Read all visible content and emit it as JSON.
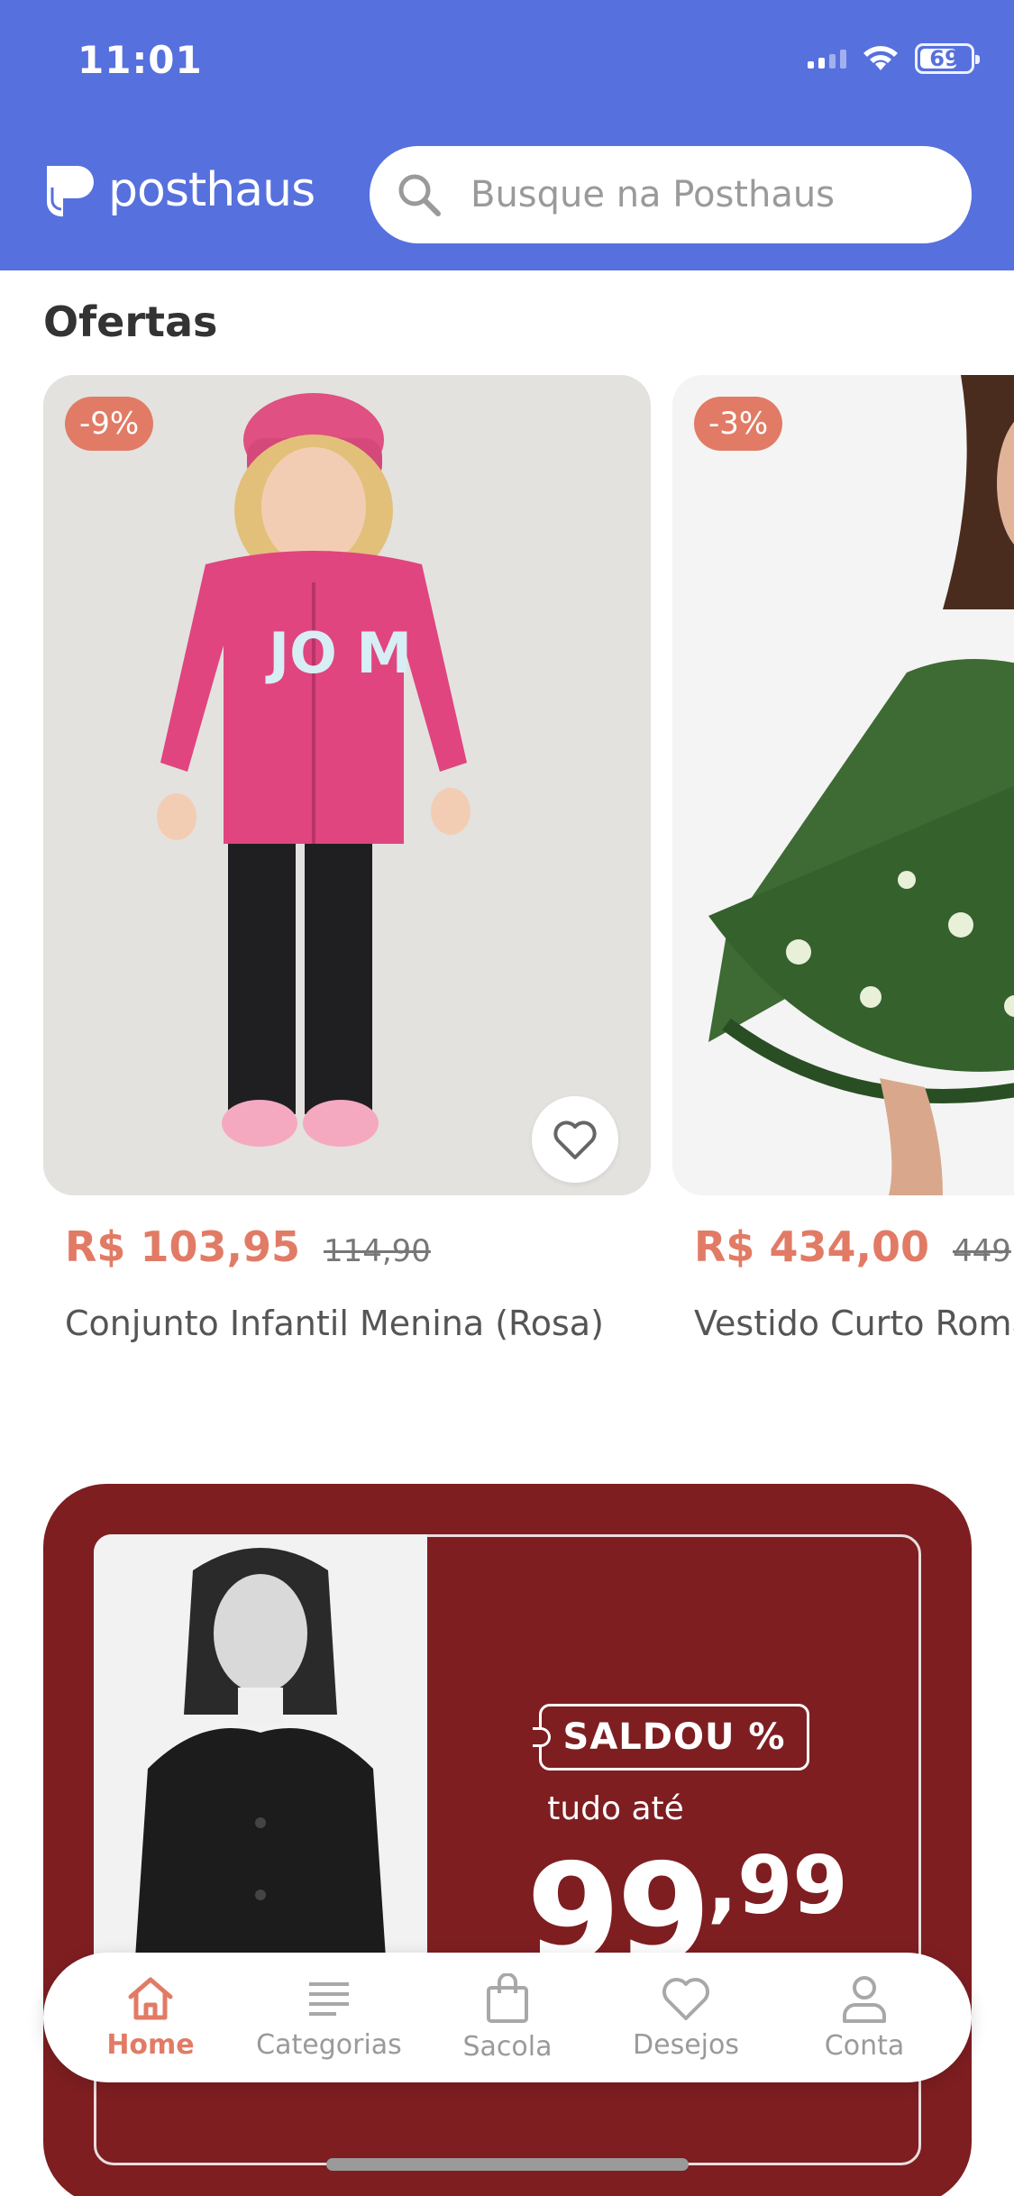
{
  "status_bar": {
    "time": "11:01",
    "battery": "69"
  },
  "header": {
    "logo_text": "posthaus",
    "search_placeholder": "Busque na Posthaus"
  },
  "section": {
    "title": "Ofertas"
  },
  "products": [
    {
      "discount": "-9%",
      "price": "R$ 103,95",
      "old_price": "114,90",
      "name": "Conjunto Infantil Menina (Rosa)"
    },
    {
      "discount": "-3%",
      "price": "R$ 434,00",
      "old_price": "449",
      "name": "Vestido Curto Roma"
    }
  ],
  "banner": {
    "tag": "SALDOU %",
    "subtitle": "tudo até",
    "price_int": "99",
    "price_cents": ",99"
  },
  "tabbar": {
    "items": [
      {
        "label": "Home",
        "icon": "home-icon",
        "active": true
      },
      {
        "label": "Categorias",
        "icon": "list-icon",
        "active": false
      },
      {
        "label": "Sacola",
        "icon": "bag-icon",
        "active": false
      },
      {
        "label": "Desejos",
        "icon": "heart-icon",
        "active": false
      },
      {
        "label": "Conta",
        "icon": "user-icon",
        "active": false
      }
    ]
  },
  "colors": {
    "header": "#5670de",
    "accent": "#e17b65",
    "banner": "#7e1e21"
  }
}
